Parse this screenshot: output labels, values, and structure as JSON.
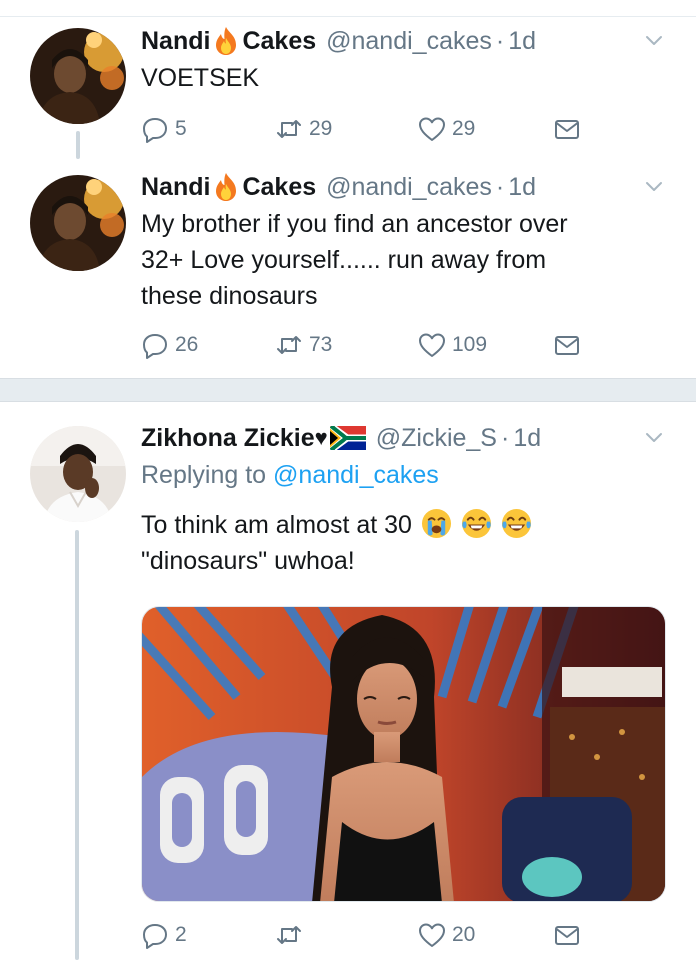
{
  "tweets": [
    {
      "display_name_part1": "Nandi",
      "display_name_part2": "Cakes",
      "handle": "@nandi_cakes",
      "time": "1d",
      "text": [
        "VOETSEK"
      ],
      "replies": "5",
      "retweets": "29",
      "likes": "29"
    },
    {
      "display_name_part1": "Nandi",
      "display_name_part2": "Cakes",
      "handle": "@nandi_cakes",
      "time": "1d",
      "text": [
        "My brother if you find an ancestor over",
        "32+ Love yourself...... run away from",
        "these dinosaurs"
      ],
      "replies": "26",
      "retweets": "73",
      "likes": "109"
    },
    {
      "display_name": "Zikhona Zickie",
      "handle": "@Zickie_S",
      "time": "1d",
      "replying_label": "Replying to",
      "replying_mention": "@nandi_cakes",
      "text": [
        "To think am almost at 30",
        "\"dinosaurs\" uwhoa!"
      ],
      "replies": "2",
      "retweets": "",
      "likes": "20"
    }
  ],
  "separator": "·",
  "heart_char": "♥",
  "icons": {
    "caret": "chevron-down-icon",
    "reply": "reply-icon",
    "retweet": "retweet-icon",
    "like": "heart-icon",
    "dm": "envelope-icon",
    "fire": "fire-emoji-icon",
    "flag": "south-africa-flag-icon",
    "crying": "loudly-crying-face-emoji",
    "laughing": "tears-of-joy-emoji"
  },
  "colors": {
    "accent": "#1da1f2",
    "secondary_text": "#657786",
    "primary_text": "#14171a",
    "divider": "#e6ecf0"
  }
}
